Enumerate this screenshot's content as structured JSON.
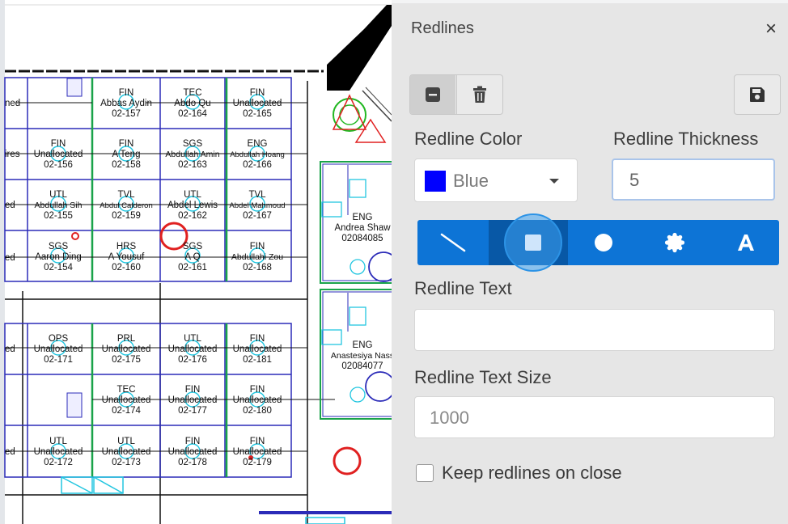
{
  "panel": {
    "title": "Redlines",
    "close_glyph": "×",
    "toolbar": {
      "buttons": [
        {
          "icon": "minus-square-icon",
          "active": true
        },
        {
          "icon": "trash-icon",
          "active": false
        }
      ],
      "save_icon": "floppy-disk-icon"
    },
    "color_label": "Redline Color",
    "color_value": "Blue",
    "color_hex": "#0000ff",
    "thickness_label": "Redline Thickness",
    "thickness_value": "5",
    "shape_tools": [
      {
        "icon": "line-icon",
        "active": false
      },
      {
        "icon": "square-icon",
        "active": true
      },
      {
        "icon": "circle-icon",
        "active": false
      },
      {
        "icon": "badge-icon",
        "active": false
      },
      {
        "icon": "text-a-icon",
        "active": false
      }
    ],
    "text_label": "Redline Text",
    "text_value": "",
    "text_size_label": "Redline Text Size",
    "text_size_placeholder": "1000",
    "keep_label": "Keep redlines on close",
    "keep_checked": false
  },
  "floorplan": {
    "offices": [
      {
        "dept": "ENG",
        "name": "Andrea Shaw",
        "id": "02084085"
      },
      {
        "dept": "ENG",
        "name": "Anastesiya Nass",
        "id": "02084077"
      }
    ],
    "cubicles": [
      {
        "dept": "",
        "name": "ned",
        "id": ""
      },
      {
        "dept": "FIN",
        "name": "Abbas Aydin",
        "id": "02-157"
      },
      {
        "dept": "TEC",
        "name": "Abdo Qu",
        "id": "02-164"
      },
      {
        "dept": "FIN",
        "name": "Unallocated",
        "id": "02-165"
      },
      {
        "dept": "",
        "name": "ires",
        "id": ""
      },
      {
        "dept": "FIN",
        "name": "Unallocated",
        "id": "02-156"
      },
      {
        "dept": "FIN",
        "name": "A Teng",
        "id": "02-158"
      },
      {
        "dept": "SGS",
        "name": "Abdullah Amin",
        "id": "02-163"
      },
      {
        "dept": "ENG",
        "name": "Abdullah Hoang",
        "id": "02-166"
      },
      {
        "dept": "",
        "name": "ed",
        "id": ""
      },
      {
        "dept": "UTL",
        "name": "Abdullah Sih",
        "id": "02-155"
      },
      {
        "dept": "TVL",
        "name": "Abdul Calderon",
        "id": "02-159"
      },
      {
        "dept": "UTL",
        "name": "Abdel Lewis",
        "id": "02-162"
      },
      {
        "dept": "TVL",
        "name": "Abdel Mahmoud",
        "id": "02-167"
      },
      {
        "dept": "",
        "name": "ed",
        "id": ""
      },
      {
        "dept": "SGS",
        "name": "Aaron Ding",
        "id": "02-154"
      },
      {
        "dept": "HRS",
        "name": "A Yousuf",
        "id": "02-160"
      },
      {
        "dept": "SGS",
        "name": "A Q",
        "id": "02-161"
      },
      {
        "dept": "FIN",
        "name": "Abdullahi Zou",
        "id": "02-168"
      },
      {
        "dept": "",
        "name": "ed",
        "id": ""
      },
      {
        "dept": "OPS",
        "name": "Unallocated",
        "id": "02-171"
      },
      {
        "dept": "PRL",
        "name": "Unallocated",
        "id": "02-175"
      },
      {
        "dept": "UTL",
        "name": "Unallocated",
        "id": "02-176"
      },
      {
        "dept": "FIN",
        "name": "Unallocated",
        "id": "02-181"
      },
      {
        "dept": "TEC",
        "name": "Unallocated",
        "id": "02-174"
      },
      {
        "dept": "FIN",
        "name": "Unallocated",
        "id": "02-177"
      },
      {
        "dept": "FIN",
        "name": "Unallocated",
        "id": "02-180"
      },
      {
        "dept": "",
        "name": "ed",
        "id": ""
      },
      {
        "dept": "UTL",
        "name": "Unallocated",
        "id": "02-172"
      },
      {
        "dept": "UTL",
        "name": "Unallocated",
        "id": "02-173"
      },
      {
        "dept": "FIN",
        "name": "Unallocated",
        "id": "02-178"
      },
      {
        "dept": "FIN",
        "name": "Unallocated",
        "id": "02-179"
      }
    ]
  }
}
